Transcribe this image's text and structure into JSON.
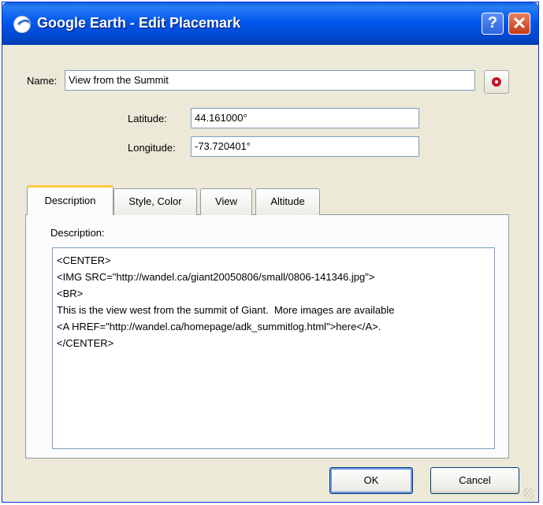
{
  "window": {
    "title": "Google Earth - Edit Placemark",
    "help_glyph": "?",
    "close_glyph": "✕",
    "app_icon": "google-earth-icon"
  },
  "form": {
    "name_label": "Name:",
    "name_value": "View from the Summit",
    "latitude_label": "Latitude:",
    "latitude_value": "44.161000°",
    "longitude_label": "Longitude:",
    "longitude_value": "-73.720401°",
    "placemark_icon": "placemark-pin-icon"
  },
  "tabs": [
    {
      "label": "Description",
      "active": true
    },
    {
      "label": "Style, Color",
      "active": false
    },
    {
      "label": "View",
      "active": false
    },
    {
      "label": "Altitude",
      "active": false
    }
  ],
  "description": {
    "label": "Description:",
    "lines": [
      "<CENTER>",
      "<IMG SRC=\"http://wandel.ca/giant20050806/small/0806-141346.jpg\">",
      "<BR>",
      "This is the view west from the summit of Giant.  More images are available",
      "<A HREF=\"http://wandel.ca/homepage/adk_summitlog.html\">here</A>.",
      "</CENTER>"
    ]
  },
  "buttons": {
    "ok_label": "OK",
    "cancel_label": "Cancel"
  },
  "colors": {
    "titlebar": "#0058ee",
    "dialog_bg": "#ece9d8",
    "active_tab_accent": "#ffc83c",
    "close_button": "#c43b16"
  }
}
